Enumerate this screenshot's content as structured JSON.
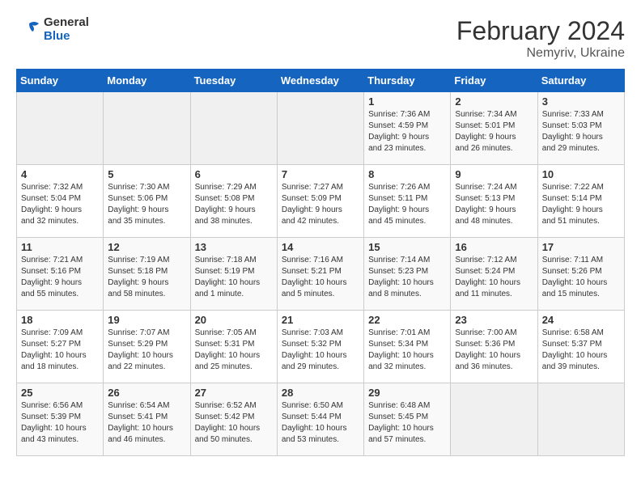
{
  "header": {
    "logo_line1": "General",
    "logo_line2": "Blue",
    "month": "February 2024",
    "location": "Nemyriv, Ukraine"
  },
  "weekdays": [
    "Sunday",
    "Monday",
    "Tuesday",
    "Wednesday",
    "Thursday",
    "Friday",
    "Saturday"
  ],
  "weeks": [
    [
      {
        "day": "",
        "info": ""
      },
      {
        "day": "",
        "info": ""
      },
      {
        "day": "",
        "info": ""
      },
      {
        "day": "",
        "info": ""
      },
      {
        "day": "1",
        "info": "Sunrise: 7:36 AM\nSunset: 4:59 PM\nDaylight: 9 hours\nand 23 minutes."
      },
      {
        "day": "2",
        "info": "Sunrise: 7:34 AM\nSunset: 5:01 PM\nDaylight: 9 hours\nand 26 minutes."
      },
      {
        "day": "3",
        "info": "Sunrise: 7:33 AM\nSunset: 5:03 PM\nDaylight: 9 hours\nand 29 minutes."
      }
    ],
    [
      {
        "day": "4",
        "info": "Sunrise: 7:32 AM\nSunset: 5:04 PM\nDaylight: 9 hours\nand 32 minutes."
      },
      {
        "day": "5",
        "info": "Sunrise: 7:30 AM\nSunset: 5:06 PM\nDaylight: 9 hours\nand 35 minutes."
      },
      {
        "day": "6",
        "info": "Sunrise: 7:29 AM\nSunset: 5:08 PM\nDaylight: 9 hours\nand 38 minutes."
      },
      {
        "day": "7",
        "info": "Sunrise: 7:27 AM\nSunset: 5:09 PM\nDaylight: 9 hours\nand 42 minutes."
      },
      {
        "day": "8",
        "info": "Sunrise: 7:26 AM\nSunset: 5:11 PM\nDaylight: 9 hours\nand 45 minutes."
      },
      {
        "day": "9",
        "info": "Sunrise: 7:24 AM\nSunset: 5:13 PM\nDaylight: 9 hours\nand 48 minutes."
      },
      {
        "day": "10",
        "info": "Sunrise: 7:22 AM\nSunset: 5:14 PM\nDaylight: 9 hours\nand 51 minutes."
      }
    ],
    [
      {
        "day": "11",
        "info": "Sunrise: 7:21 AM\nSunset: 5:16 PM\nDaylight: 9 hours\nand 55 minutes."
      },
      {
        "day": "12",
        "info": "Sunrise: 7:19 AM\nSunset: 5:18 PM\nDaylight: 9 hours\nand 58 minutes."
      },
      {
        "day": "13",
        "info": "Sunrise: 7:18 AM\nSunset: 5:19 PM\nDaylight: 10 hours\nand 1 minute."
      },
      {
        "day": "14",
        "info": "Sunrise: 7:16 AM\nSunset: 5:21 PM\nDaylight: 10 hours\nand 5 minutes."
      },
      {
        "day": "15",
        "info": "Sunrise: 7:14 AM\nSunset: 5:23 PM\nDaylight: 10 hours\nand 8 minutes."
      },
      {
        "day": "16",
        "info": "Sunrise: 7:12 AM\nSunset: 5:24 PM\nDaylight: 10 hours\nand 11 minutes."
      },
      {
        "day": "17",
        "info": "Sunrise: 7:11 AM\nSunset: 5:26 PM\nDaylight: 10 hours\nand 15 minutes."
      }
    ],
    [
      {
        "day": "18",
        "info": "Sunrise: 7:09 AM\nSunset: 5:27 PM\nDaylight: 10 hours\nand 18 minutes."
      },
      {
        "day": "19",
        "info": "Sunrise: 7:07 AM\nSunset: 5:29 PM\nDaylight: 10 hours\nand 22 minutes."
      },
      {
        "day": "20",
        "info": "Sunrise: 7:05 AM\nSunset: 5:31 PM\nDaylight: 10 hours\nand 25 minutes."
      },
      {
        "day": "21",
        "info": "Sunrise: 7:03 AM\nSunset: 5:32 PM\nDaylight: 10 hours\nand 29 minutes."
      },
      {
        "day": "22",
        "info": "Sunrise: 7:01 AM\nSunset: 5:34 PM\nDaylight: 10 hours\nand 32 minutes."
      },
      {
        "day": "23",
        "info": "Sunrise: 7:00 AM\nSunset: 5:36 PM\nDaylight: 10 hours\nand 36 minutes."
      },
      {
        "day": "24",
        "info": "Sunrise: 6:58 AM\nSunset: 5:37 PM\nDaylight: 10 hours\nand 39 minutes."
      }
    ],
    [
      {
        "day": "25",
        "info": "Sunrise: 6:56 AM\nSunset: 5:39 PM\nDaylight: 10 hours\nand 43 minutes."
      },
      {
        "day": "26",
        "info": "Sunrise: 6:54 AM\nSunset: 5:41 PM\nDaylight: 10 hours\nand 46 minutes."
      },
      {
        "day": "27",
        "info": "Sunrise: 6:52 AM\nSunset: 5:42 PM\nDaylight: 10 hours\nand 50 minutes."
      },
      {
        "day": "28",
        "info": "Sunrise: 6:50 AM\nSunset: 5:44 PM\nDaylight: 10 hours\nand 53 minutes."
      },
      {
        "day": "29",
        "info": "Sunrise: 6:48 AM\nSunset: 5:45 PM\nDaylight: 10 hours\nand 57 minutes."
      },
      {
        "day": "",
        "info": ""
      },
      {
        "day": "",
        "info": ""
      }
    ]
  ]
}
